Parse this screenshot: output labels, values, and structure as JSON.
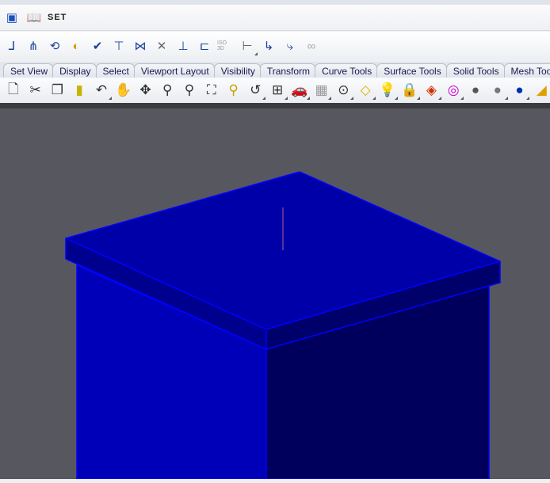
{
  "header": {
    "title": "SET",
    "icons": [
      "piping-app-icon",
      "setup-book-icon"
    ]
  },
  "piping_toolbar": {
    "icons": [
      "pipe-route-icon",
      "connect-icon",
      "rotate-angle-icon",
      "cap-icon",
      "support-icon",
      "hanger-icon",
      "valve-icon",
      "cross-icon",
      "branch-valve-icon",
      "elbow-icon",
      "iso-3d-icon",
      "dimension-icon",
      "pipe-bend-icon",
      "pipe-select-icon",
      "link-icon"
    ],
    "iso_label": "ISO 3D"
  },
  "tabs": [
    "Set View",
    "Display",
    "Select",
    "Viewport Layout",
    "Visibility",
    "Transform",
    "Curve Tools",
    "Surface Tools",
    "Solid Tools",
    "Mesh Tools"
  ],
  "standard_toolbar": {
    "icons": [
      "new-icon",
      "cut-icon",
      "copy-icon",
      "paste-icon",
      "undo-icon",
      "pan-icon",
      "rotate-view-icon",
      "zoom-icon",
      "zoom-window-icon",
      "zoom-extents-icon",
      "zoom-selected-icon",
      "undo-view-icon",
      "viewport-layout-icon",
      "car-icon",
      "grid-snap-icon",
      "circle-icon",
      "object-icon",
      "light-icon",
      "lock-icon",
      "layer-icon",
      "color-wheel-icon",
      "shaded-icon",
      "ghosted-icon",
      "rendered-icon",
      "render-icon"
    ]
  },
  "viewport": {
    "background": "#57575f",
    "edge_color": "#0000ff"
  }
}
